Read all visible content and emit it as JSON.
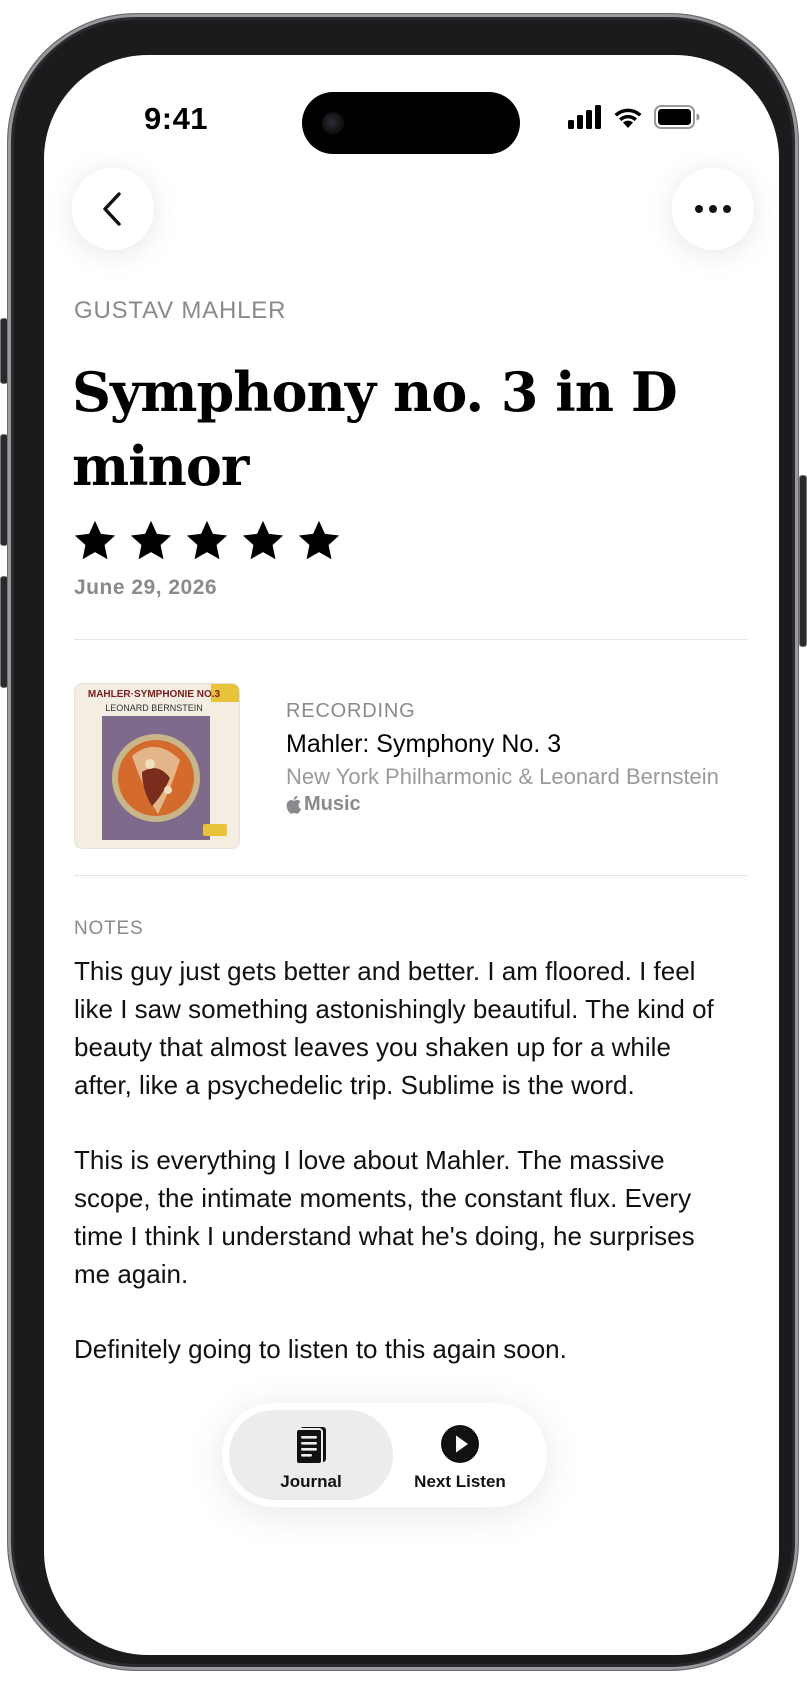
{
  "status_bar": {
    "time": "9:41"
  },
  "nav": {
    "back_icon": "chevron-left-icon",
    "more_icon": "ellipsis-icon"
  },
  "work": {
    "composer": "GUSTAV MAHLER",
    "title": "Symphony no. 3 in D minor",
    "rating": 5,
    "rating_max": 5,
    "date": "June 29, 2026"
  },
  "recording": {
    "section_label": "RECORDING",
    "title": "Mahler: Symphony No. 3",
    "artist": "New York Philharmonic & Leonard Bernstein",
    "service": "Music",
    "album_cover": {
      "line1": "MAHLER·SYMPHONIE NO.3",
      "line2": "LEONARD BERNSTEIN"
    }
  },
  "notes": {
    "section_label": "NOTES",
    "paragraphs": [
      "This guy just gets better and better. I am floored. I feel like I saw something astonishingly beautiful. The kind of beauty that almost leaves you shaken up for a while after, like a psychedelic trip. Sublime is the word.",
      "This is everything I love about Mahler. The massive scope, the intimate moments, the constant flux. Every time I think I understand what he's doing, he surprises me again.",
      "Definitely going to listen to this again soon."
    ]
  },
  "tabbar": {
    "tabs": [
      {
        "label": "Journal",
        "icon": "journal-icon",
        "active": true
      },
      {
        "label": "Next Listen",
        "icon": "play-circle-icon",
        "active": false
      }
    ]
  }
}
